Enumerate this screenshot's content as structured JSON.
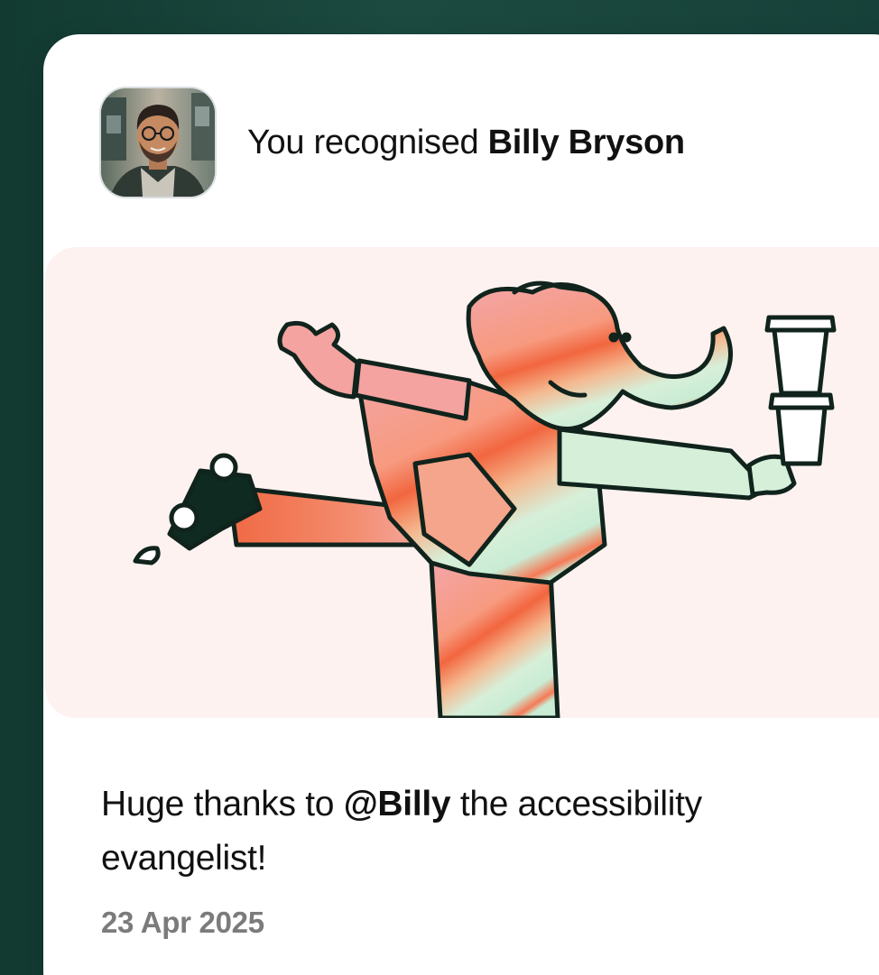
{
  "recognition": {
    "prefix": "You recognised",
    "recipient": "Billy Bryson"
  },
  "message": {
    "before": "Huge thanks to",
    "mention": "@Billy",
    "after": "the accessibility evangelist!"
  },
  "date": "23 Apr 2025",
  "colors": {
    "background": "#1c4a40",
    "card": "#ffffff",
    "illustration_bg": "#fdf2ef",
    "date_text": "#7b7b7b"
  },
  "icons": {
    "avatar": "profile-photo-man-glasses",
    "illustration": "elephant-carrying-coffee-cups-and-camera"
  }
}
